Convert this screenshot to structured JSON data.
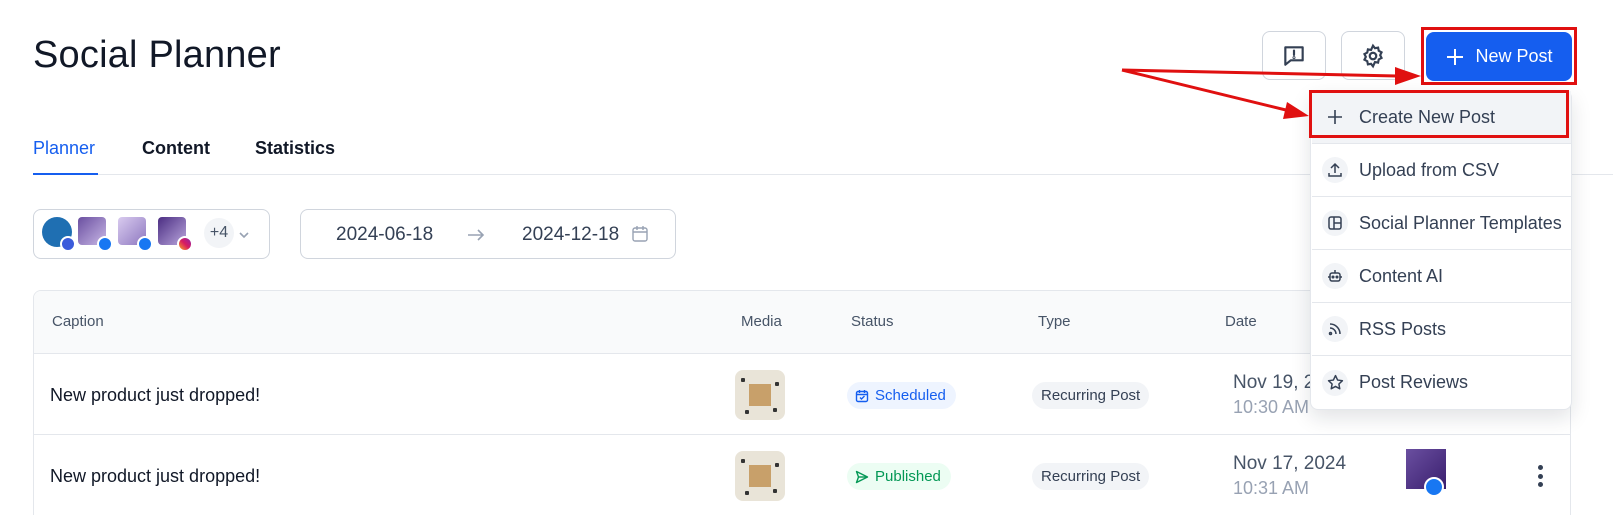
{
  "header": {
    "title": "Social Planner",
    "new_post_label": "New Post"
  },
  "tabs": [
    {
      "label": "Planner",
      "active": true
    },
    {
      "label": "Content",
      "active": false
    },
    {
      "label": "Statistics",
      "active": false
    }
  ],
  "filters": {
    "extra_accounts": "+4",
    "date_from": "2024-06-18",
    "date_to": "2024-12-18"
  },
  "table": {
    "columns": [
      "Caption",
      "Media",
      "Status",
      "Type",
      "Date"
    ],
    "rows": [
      {
        "caption": "New product just dropped!",
        "status": "Scheduled",
        "type": "Recurring Post",
        "date": "Nov 19, 2024",
        "time": "10:30 AM"
      },
      {
        "caption": "New product just dropped!",
        "status": "Published",
        "type": "Recurring Post",
        "date": "Nov 17, 2024",
        "time": "10:31 AM"
      }
    ]
  },
  "dropdown": {
    "items": [
      {
        "label": "Create New Post",
        "icon": "plus-icon"
      },
      {
        "label": "Upload from CSV",
        "icon": "upload-icon"
      },
      {
        "label": "Social Planner Templates",
        "icon": "template-icon"
      },
      {
        "label": "Content AI",
        "icon": "robot-icon"
      },
      {
        "label": "RSS Posts",
        "icon": "rss-icon"
      },
      {
        "label": "Post Reviews",
        "icon": "star-icon"
      }
    ]
  },
  "colors": {
    "primary": "#155eef",
    "annotation": "#e01010",
    "scheduled": "#155eef",
    "published": "#039855"
  }
}
